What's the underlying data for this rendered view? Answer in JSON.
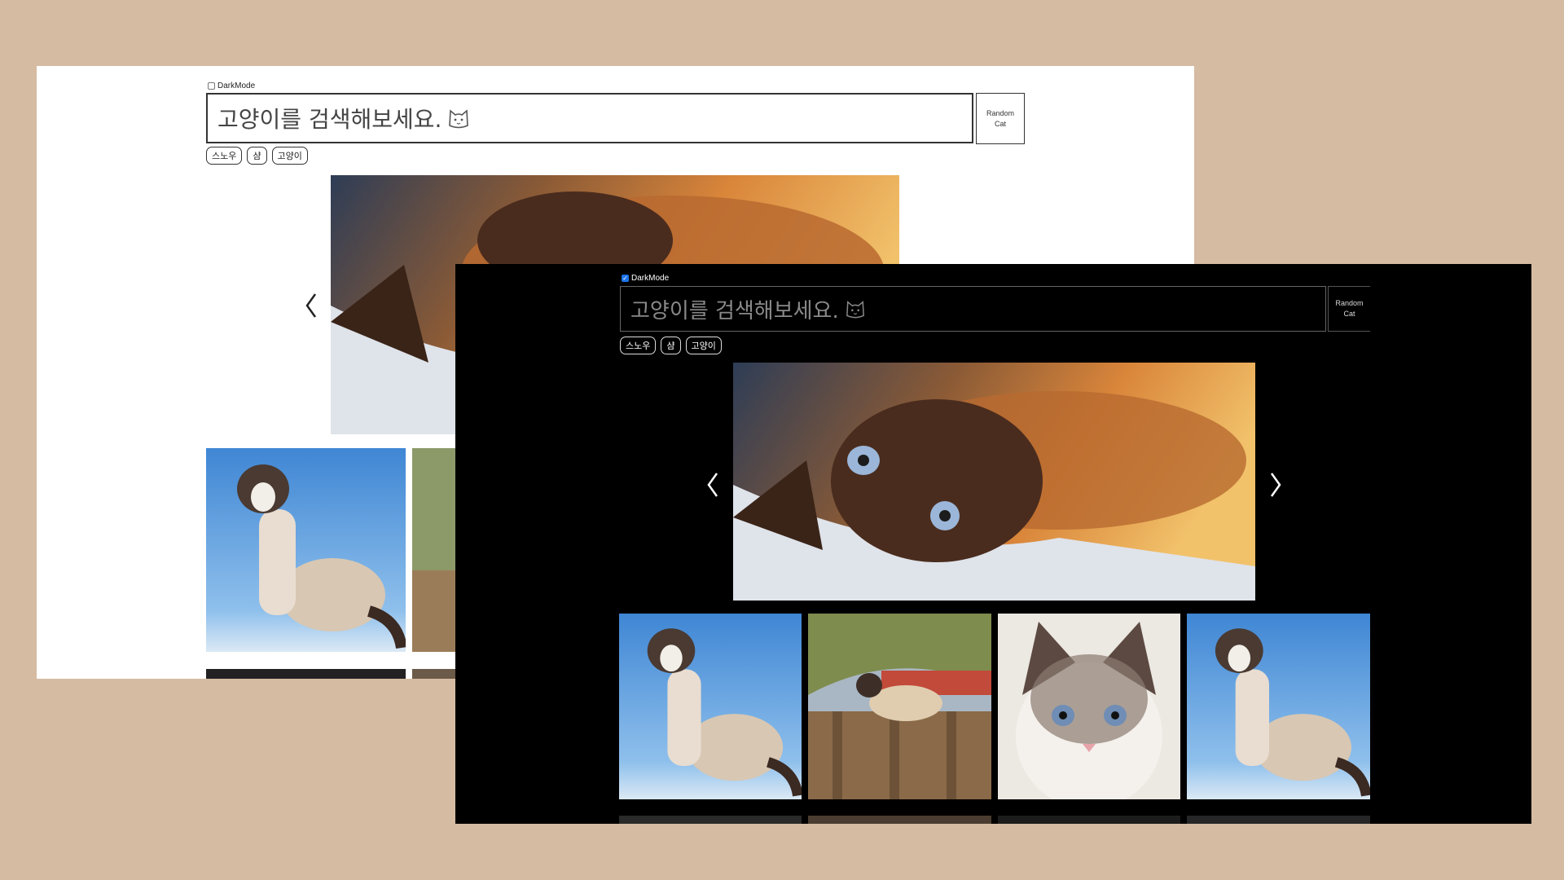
{
  "light_window": {
    "darkmode_label": "DarkMode",
    "darkmode_checked": false,
    "search_placeholder": "고양이를 검색해보세요.",
    "random_button": "Random\nCat",
    "keywords": [
      "스노우",
      "샴",
      "고양이"
    ]
  },
  "dark_window": {
    "darkmode_label": "DarkMode",
    "darkmode_checked": true,
    "search_placeholder": "고양이를 검색해보세요.",
    "random_button": "Random\nCat",
    "keywords": [
      "스노우",
      "샴",
      "고양이"
    ]
  },
  "colors": {
    "page_background": "#d5bba2",
    "light_bg": "#ffffff",
    "dark_bg": "#000000",
    "checkbox_checked": "#1a73e8"
  },
  "icons": [
    "cat-face-icon",
    "chevron-left-icon",
    "chevron-right-icon"
  ]
}
